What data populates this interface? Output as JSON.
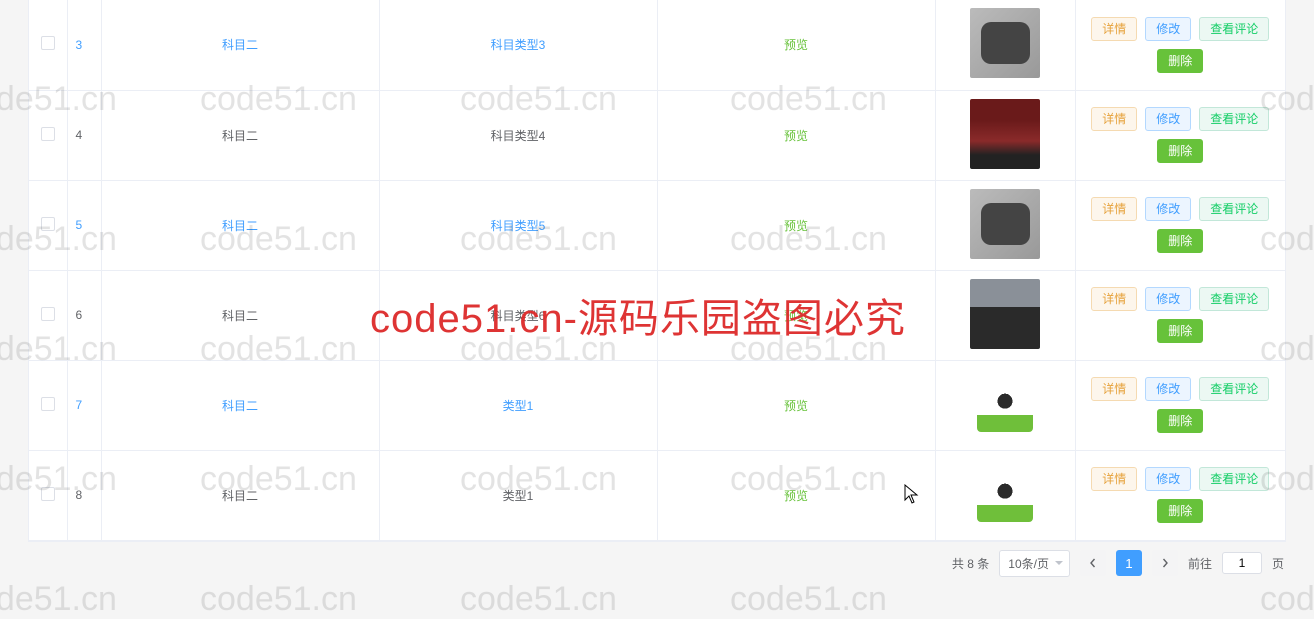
{
  "labels": {
    "detail": "详情",
    "edit": "修改",
    "view_comments": "查看评论",
    "delete": "删除",
    "preview": "预览",
    "total_prefix": "共 ",
    "total_suffix": " 条",
    "per_page": "10条/页",
    "goto": "前往",
    "page_suffix": "页"
  },
  "rows": [
    {
      "id": "3",
      "subject": "科目二",
      "type": "科目类型3",
      "thumb": "rk"
    },
    {
      "id": "4",
      "subject": "科目二",
      "type": "科目类型4",
      "thumb": "suv"
    },
    {
      "id": "5",
      "subject": "科目二",
      "type": "科目类型5",
      "thumb": "rk"
    },
    {
      "id": "6",
      "subject": "科目二",
      "type": "科目类型6",
      "thumb": "muscle"
    },
    {
      "id": "7",
      "subject": "科目二",
      "type": "类型1",
      "thumb": "illus"
    },
    {
      "id": "8",
      "subject": "科目二",
      "type": "类型1",
      "thumb": "illus"
    }
  ],
  "pagination": {
    "total": 8,
    "current": 1,
    "jump": 1
  },
  "watermarks": {
    "small": "code51.cn",
    "big": "code51.cn-源码乐园盗图必究"
  }
}
